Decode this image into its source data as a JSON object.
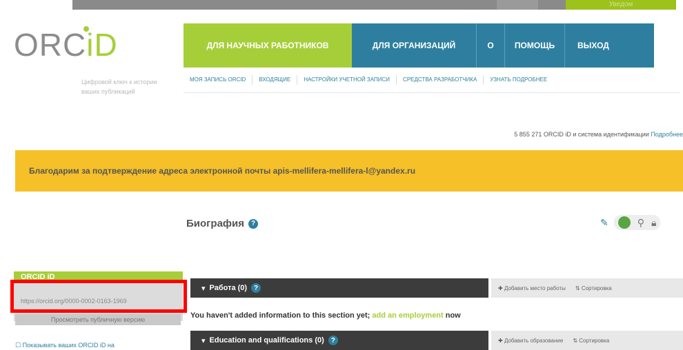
{
  "top_bar": {
    "sign_in": "Уведом"
  },
  "logo": {
    "orc": "ORC",
    "id": "iD"
  },
  "tagline": "Цифровой ключ к истории ваших публикаций",
  "nav": {
    "researchers": "ДЛЯ НАУЧНЫХ РАБОТНИКОВ",
    "organizations": "ДЛЯ ОРГАНИЗАЦИЙ",
    "about": "О",
    "help": "ПОМОЩЬ",
    "logout": "ВЫХОД"
  },
  "subnav": [
    "МОЯ ЗАПИСЬ ORCID",
    "ВХОДЯЩИЕ",
    "НАСТРОЙКИ УЧЕТНОЙ ЗАПИСИ",
    "СРЕДСТВА РАЗРАБОТЧИКА",
    "УЗНАТЬ ПОДРОБНЕЕ"
  ],
  "stats": {
    "text": "5 855 271 ORCID iD и система идентификации",
    "link": "Подробнее"
  },
  "banner": "Благодарим за подтверждение адреса электронной почты apis-mellifera-mellifera-l@yandex.ru",
  "biography": {
    "title": "Биография"
  },
  "sidebar": {
    "orcid_heading": "ORCID iD",
    "orcid_url": "https://orcid.org/0000-0002-0163-1969",
    "public_button": "Просмотреть публичную версию",
    "bottom_link": "Показывать ваших ORCID iD на"
  },
  "sections": {
    "work": {
      "title": "Работа (0)",
      "add": "Добавить место работы",
      "sort": "Сортировка"
    },
    "empty_prefix": "You haven't added information to this section yet; ",
    "empty_link": "add an employment",
    "empty_suffix": " now",
    "education": {
      "title": "Education and qualifications (0)",
      "add": "Добавить образование",
      "sort": "Сортировка"
    }
  },
  "colors": {
    "orcid_green": "#a6ce39",
    "nav_blue": "#2e7f9f",
    "banner_yellow": "#f5c028",
    "section_dark": "#3c3c3c",
    "highlight_red": "#ff0000"
  }
}
